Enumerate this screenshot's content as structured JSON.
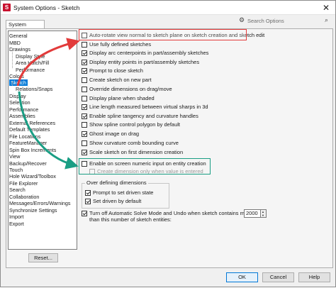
{
  "window": {
    "title": "System Options - Sketch",
    "close": "✕",
    "app_icon": "S"
  },
  "tab": {
    "label": "System Options"
  },
  "search": {
    "placeholder": "Search Options",
    "gear_icon": "gear-icon",
    "search_icon": "search-icon"
  },
  "tree": {
    "items": [
      {
        "label": "General",
        "sub": false
      },
      {
        "label": "MBD",
        "sub": false
      },
      {
        "label": "Drawings",
        "sub": false
      },
      {
        "label": "Display Style",
        "sub": true
      },
      {
        "label": "Area Hatch/Fill",
        "sub": true
      },
      {
        "label": "Performance",
        "sub": true
      },
      {
        "label": "Colors",
        "sub": false
      },
      {
        "label": "Sketch",
        "sub": false,
        "selected": true
      },
      {
        "label": "Relations/Snaps",
        "sub": true
      },
      {
        "label": "Display",
        "sub": false
      },
      {
        "label": "Selection",
        "sub": false
      },
      {
        "label": "Performance",
        "sub": false
      },
      {
        "label": "Assemblies",
        "sub": false
      },
      {
        "label": "External References",
        "sub": false
      },
      {
        "label": "Default Templates",
        "sub": false
      },
      {
        "label": "File Locations",
        "sub": false
      },
      {
        "label": "FeatureManager",
        "sub": false
      },
      {
        "label": "Spin Box Increments",
        "sub": false
      },
      {
        "label": "View",
        "sub": false
      },
      {
        "label": "Backup/Recover",
        "sub": false
      },
      {
        "label": "Touch",
        "sub": false
      },
      {
        "label": "Hole Wizard/Toolbox",
        "sub": false
      },
      {
        "label": "File Explorer",
        "sub": false
      },
      {
        "label": "Search",
        "sub": false
      },
      {
        "label": "Collaboration",
        "sub": false
      },
      {
        "label": "Messages/Errors/Warnings",
        "sub": false
      },
      {
        "label": "Synchronize Settings",
        "sub": false
      },
      {
        "label": "Import",
        "sub": false
      },
      {
        "label": "Export",
        "sub": false
      }
    ]
  },
  "options": [
    {
      "label": "Auto-rotate view normal to sketch plane on sketch creation and sketch edit",
      "checked": false
    },
    {
      "label": "Use fully defined sketches",
      "checked": false
    },
    {
      "label": "Display arc centerpoints in part/assembly sketches",
      "checked": true
    },
    {
      "label": "Display entity points in part/assembly sketches",
      "checked": true
    },
    {
      "label": "Prompt to close sketch",
      "checked": true
    },
    {
      "label": "Create sketch on new part",
      "checked": false
    },
    {
      "label": "Override dimensions on drag/move",
      "checked": false
    },
    {
      "label": "Display plane when shaded",
      "checked": false
    },
    {
      "label": "Line length measured between virtual sharps in 3d",
      "checked": true
    },
    {
      "label": "Enable spline tangency and curvature handles",
      "checked": true
    },
    {
      "label": "Show spline control polygon by default",
      "checked": false
    },
    {
      "label": "Ghost image on drag",
      "checked": true
    },
    {
      "label": "Show curvature comb bounding curve",
      "checked": false
    },
    {
      "label": "Scale sketch on first dimension creation",
      "checked": true
    },
    {
      "label": "Enable on screen numeric input on entity creation",
      "checked": false
    }
  ],
  "sub_option": {
    "label": "Create dimension only when value is entered",
    "checked": false,
    "disabled": true
  },
  "over_defining": {
    "title": "Over defining dimensions",
    "items": [
      {
        "label": "Prompt to set driven state",
        "checked": true
      },
      {
        "label": "Set driven by default",
        "checked": true
      }
    ]
  },
  "solve_mode": {
    "line1": "Turn off Automatic Solve Mode and Undo when sketch contains more",
    "line2": "than this number of sketch entities:",
    "checked": true,
    "value": "2000"
  },
  "buttons": {
    "reset": "Reset...",
    "ok": "OK",
    "cancel": "Cancel",
    "help": "Help"
  },
  "colors": {
    "highlight_red": "#e23b3b",
    "highlight_green": "#1a9e84",
    "selected": "#0078d7"
  }
}
